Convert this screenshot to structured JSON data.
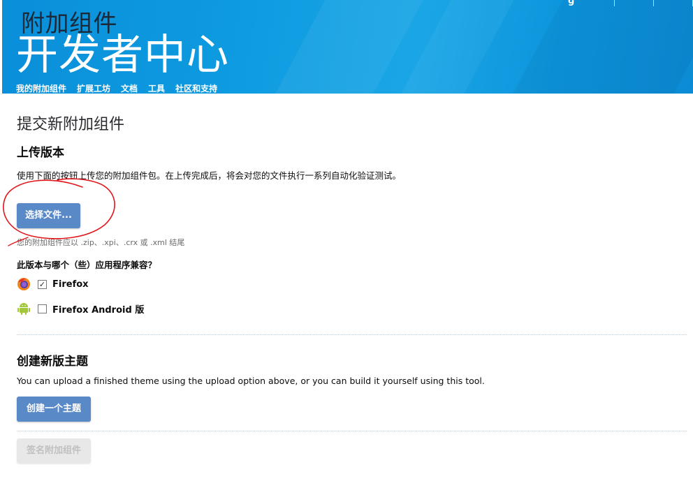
{
  "header": {
    "kicker": "附加组件",
    "title": "开发者中心",
    "top_glyph": "g",
    "nav": [
      "我的附加组件",
      "扩展工坊",
      "文档",
      "工具",
      "社区和支持"
    ]
  },
  "upload": {
    "page_title": "提交新附加组件",
    "section_title": "上传版本",
    "description": "使用下面的按钮上传您的附加组件包。在上传完成后，将会对您的文件执行一系列自动化验证测试。",
    "choose_file_label": "选择文件...",
    "hint": "您的附加组件应以 .zip、.xpi、.crx 或 .xml 结尾",
    "compat_question": "此版本与哪个（些）应用程序兼容？",
    "apps": [
      {
        "icon": "firefox-icon",
        "label": "Firefox",
        "checked": true
      },
      {
        "icon": "android-icon",
        "label": "Firefox Android 版",
        "checked": false
      }
    ]
  },
  "theme": {
    "section_title": "创建新版主题",
    "description": "You can upload a finished theme using the upload option above, or you can build it yourself using this tool.",
    "create_label": "创建一个主题"
  },
  "sign": {
    "label": "签名附加组件",
    "disabled": true
  },
  "colors": {
    "header": "#0e9be0",
    "button": "#5a89c7",
    "annotation": "#e0161b"
  }
}
